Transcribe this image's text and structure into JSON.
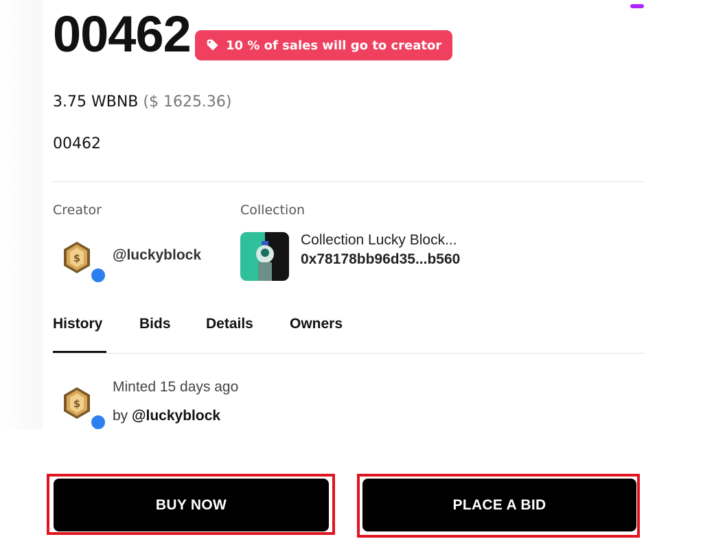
{
  "nft": {
    "title": "00462",
    "royalty_badge": "10 % of sales will go to creator",
    "price": "3.75 WBNB",
    "price_usd": "($ 1625.36)",
    "token_id": "00462"
  },
  "creator": {
    "label": "Creator",
    "handle": "@luckyblock"
  },
  "collection": {
    "label": "Collection",
    "name": "Collection Lucky Block...",
    "address": "0x78178bb96d35...b560"
  },
  "tabs": [
    {
      "label": "History",
      "active": true
    },
    {
      "label": "Bids",
      "active": false
    },
    {
      "label": "Details",
      "active": false
    },
    {
      "label": "Owners",
      "active": false
    }
  ],
  "history": {
    "event": "Minted 15 days ago",
    "by_prefix": "by",
    "by_user": "@luckyblock"
  },
  "actions": {
    "buy_now": "BUY NOW",
    "place_bid": "PLACE A BID"
  },
  "icons": {
    "badge_icon": "tag-icon",
    "avatar_icon": "gold-hex-coin-avatar",
    "status_icon": "online-dot"
  },
  "colors": {
    "badge_bg": "#ef4060",
    "button_bg": "#000000",
    "highlight_frame": "#e0141e",
    "online_dot": "#2d7ff0",
    "scroll_accent": "#b026ff"
  }
}
